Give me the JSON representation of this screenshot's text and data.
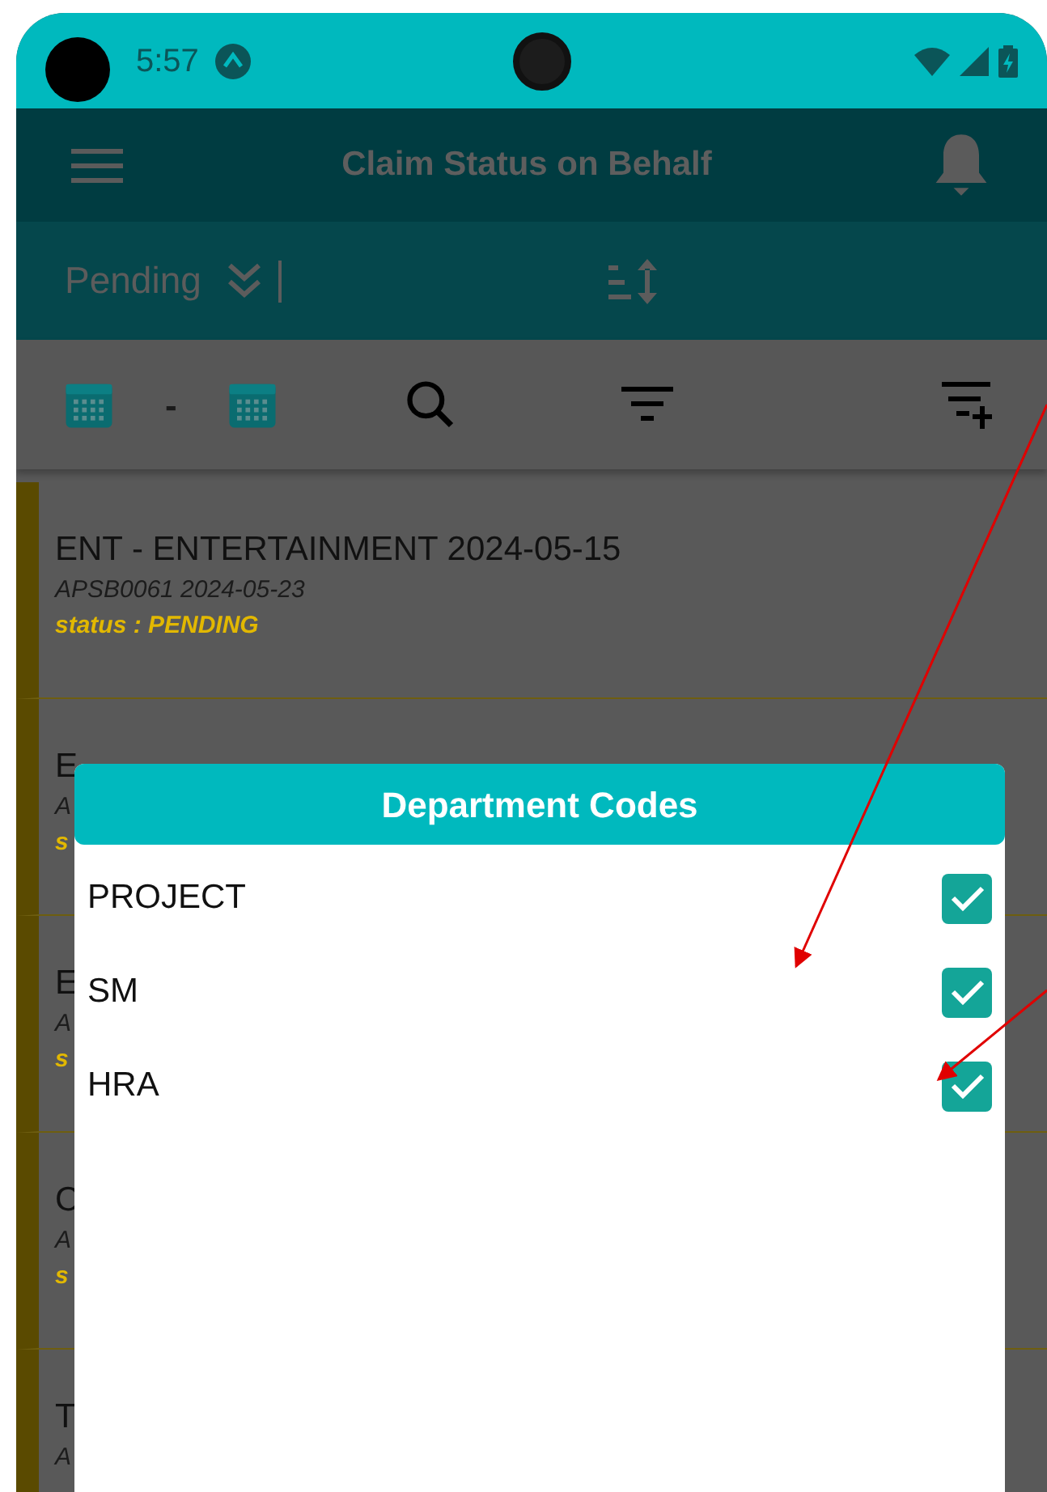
{
  "status_bar": {
    "time": "5:57"
  },
  "app_bar": {
    "title": "Claim Status on Behalf"
  },
  "status_filter": {
    "value": "Pending"
  },
  "date_range": {
    "separator": "-"
  },
  "claims": [
    {
      "title": "ENT - ENTERTAINMENT 2024-05-15",
      "subtitle": "APSB0061 2024-05-23",
      "status": "status : PENDING"
    },
    {
      "title": "E",
      "subtitle": "A",
      "status": "s"
    },
    {
      "title": "E",
      "subtitle": "A",
      "status": "s"
    },
    {
      "title": "C",
      "subtitle": "A",
      "status": "s"
    },
    {
      "title": "T",
      "subtitle": "A"
    }
  ],
  "dialog": {
    "title": "Department Codes",
    "options": [
      {
        "label": "PROJECT",
        "checked": true
      },
      {
        "label": "SM",
        "checked": true
      },
      {
        "label": "HRA",
        "checked": true
      }
    ]
  }
}
